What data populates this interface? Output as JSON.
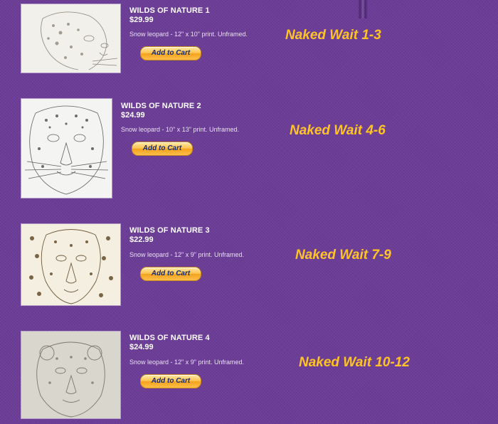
{
  "accent_color": "#ffc423",
  "background_color": "#6c3d97",
  "products": [
    {
      "name": "WILDS OF NATURE 1",
      "price": "$29.99",
      "description": "Snow leopard - 12\" x 10\" print. Unframed.",
      "button_label": "Add to Cart",
      "wait_label": "Naked Wait 1-3"
    },
    {
      "name": "WILDS OF NATURE 2",
      "price": "$24.99",
      "description": "Snow leopard - 10\" x 13\" print. Unframed.",
      "button_label": "Add to Cart",
      "wait_label": "Naked Wait 4-6"
    },
    {
      "name": "WILDS OF NATURE 3",
      "price": "$22.99",
      "description": "Snow leopard - 12\" x 9\" print. Unframed.",
      "button_label": "Add to Cart",
      "wait_label": "Naked Wait 7-9"
    },
    {
      "name": "WILDS OF NATURE 4",
      "price": "$24.99",
      "description": "Snow leopard - 12\" x 9\" print. Unframed.",
      "button_label": "Add to Cart",
      "wait_label": "Naked Wait 10-12"
    }
  ]
}
